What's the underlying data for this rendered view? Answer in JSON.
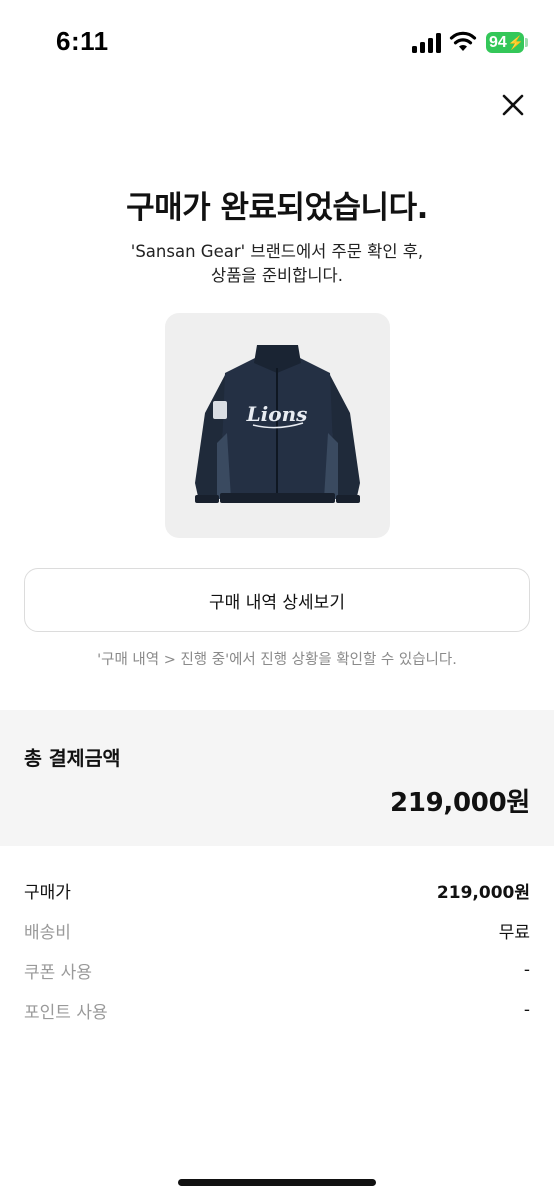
{
  "status_bar": {
    "time": "6:11",
    "battery": "94"
  },
  "header": {
    "title": "구매가 완료되었습니다.",
    "subtitle_line1": "'Sansan Gear' 브랜드에서 주문 확인 후,",
    "subtitle_line2": "상품을 준비합니다."
  },
  "product": {
    "image_icon": "jacket-image",
    "logo_text": "Lions"
  },
  "actions": {
    "detail_button_label": "구매 내역 상세보기",
    "hint": "'구매 내역 > 진행 중'에서 진행 상황을 확인할 수 있습니다."
  },
  "total": {
    "label": "총 결제금액",
    "amount": "219,000원"
  },
  "breakdown": [
    {
      "label": "구매가",
      "value": "219,000원"
    },
    {
      "label": "배송비",
      "value": "무료"
    },
    {
      "label": "쿠폰 사용",
      "value": "-"
    },
    {
      "label": "포인트 사용",
      "value": "-"
    }
  ],
  "colors": {
    "battery": "#34c759",
    "jacket": "#1f2a3a",
    "card_bg": "#efefef",
    "total_bg": "#f5f5f5"
  }
}
